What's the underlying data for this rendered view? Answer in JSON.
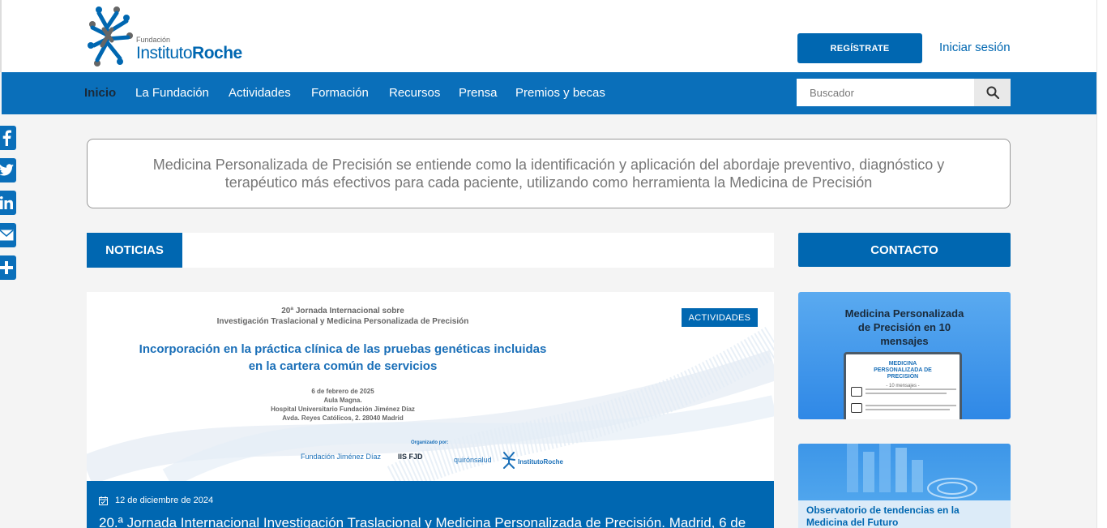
{
  "header": {
    "logo_small": "Fundación",
    "logo_big_light": "Instituto",
    "logo_big_bold": "Roche",
    "register_label": "REGÍSTRATE",
    "login_label": "Iniciar sesión"
  },
  "nav": {
    "items": [
      "Inicio",
      "La Fundación",
      "Actividades",
      "Formación",
      "Recursos",
      "Prensa",
      "Premios y becas"
    ],
    "search_placeholder": "Buscador"
  },
  "intro": {
    "text": "Medicina Personalizada de Precisión se entiende como la identificación y aplicación del abordaje preventivo, diagnóstico y terapéutico más efectivos para cada paciente, utilizando como herramienta la Medicina de Precisión"
  },
  "sections": {
    "news_label": "NOTICIAS",
    "contact_label": "CONTACTO"
  },
  "news": {
    "image": {
      "line1": "20ª Jornada Internacional sobre",
      "line2": "Investigación Traslacional y Medicina Personalizada de Precisión",
      "title1": "Incorporación en la práctica clínica de las pruebas genéticas incluidas",
      "title2": "en la cartera común de servicios",
      "details": [
        "6 de febrero de 2025",
        "Aula Magna.",
        "Hospital Universitario Fundación Jiménez Díaz",
        "Avda. Reyes Católicos, 2. 28040 Madrid"
      ],
      "organized": "Organizado por:",
      "org_logos": [
        "Fundación Jiménez Díaz",
        "IIS FJD",
        "quirónsalud",
        "InstitutoRoche"
      ]
    },
    "badge": "ACTIVIDADES",
    "date": "12 de diciembre de 2024",
    "title": "20.ª Jornada Internacional Investigación Traslacional y Medicina Personalizada de Precisión. Madrid, 6 de"
  },
  "sidebar": {
    "card1_title": "Medicina Personalizada de Precisión en 10 mensajes",
    "card1_doc_title": "MEDICINA PERSONALIZADA DE PRECISIÓN",
    "card1_doc_sub": "- 10 mensajes -",
    "card2_caption": "Observatorio de tendencias en la Medicina del Futuro"
  },
  "colors": {
    "brand_blue": "#0067b1",
    "nav_blue": "#0a6fba"
  },
  "social_icons": [
    "facebook-icon",
    "twitter-icon",
    "linkedin-icon",
    "email-icon",
    "share-icon"
  ]
}
